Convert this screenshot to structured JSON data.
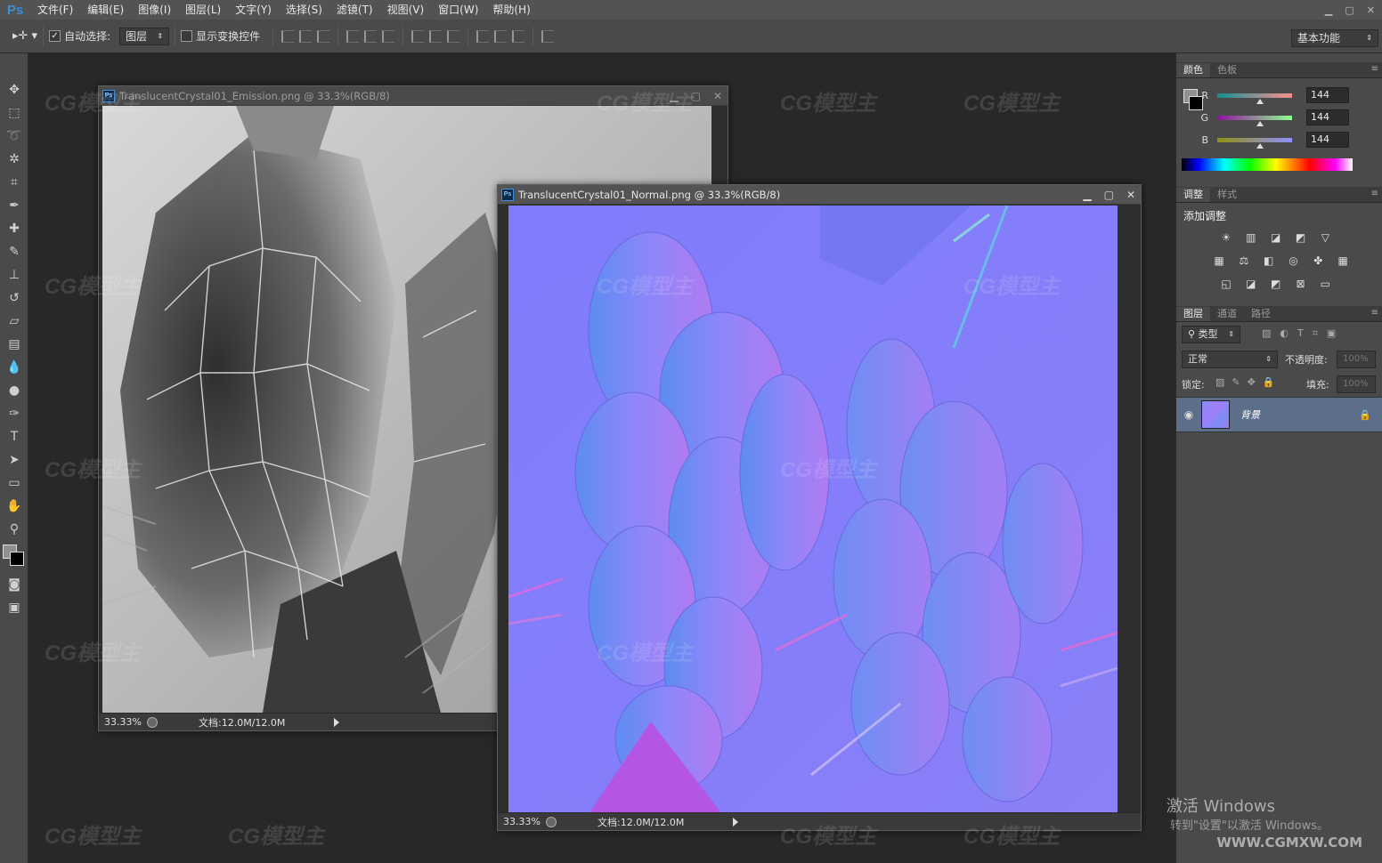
{
  "menubar": {
    "logo": "Ps",
    "items": [
      "文件(F)",
      "编辑(E)",
      "图像(I)",
      "图层(L)",
      "文字(Y)",
      "选择(S)",
      "滤镜(T)",
      "视图(V)",
      "窗口(W)",
      "帮助(H)"
    ]
  },
  "options": {
    "auto_select_label": "自动选择:",
    "auto_select_value": "图层",
    "show_transform_label": "显示变换控件",
    "workspace": "基本功能"
  },
  "doc1": {
    "title": "TranslucentCrystal01_Emission.png @ 33.3%(RGB/8)",
    "zoom": "33.33%",
    "doc_info": "文档:12.0M/12.0M"
  },
  "doc2": {
    "title": "TranslucentCrystal01_Normal.png @ 33.3%(RGB/8)",
    "zoom": "33.33%",
    "doc_info": "文档:12.0M/12.0M"
  },
  "color_panel": {
    "tabs": [
      "颜色",
      "色板"
    ],
    "channels": [
      {
        "label": "R",
        "value": "144"
      },
      {
        "label": "G",
        "value": "144"
      },
      {
        "label": "B",
        "value": "144"
      }
    ]
  },
  "adjust_panel": {
    "tabs": [
      "调整",
      "样式"
    ],
    "add_label": "添加调整"
  },
  "layers_panel": {
    "tabs": [
      "图层",
      "通道",
      "路径"
    ],
    "filter_label": "类型",
    "blend_mode": "正常",
    "opacity_label": "不透明度:",
    "opacity_value": "100%",
    "lock_label": "锁定:",
    "fill_label": "填充:",
    "fill_value": "100%",
    "layer_name": "背景"
  },
  "overlay": {
    "watermark": "CG模型主",
    "activate_title": "激活 Windows",
    "activate_sub": "转到\"设置\"以激活 Windows。",
    "site": "WWW.CGMXW.COM"
  }
}
